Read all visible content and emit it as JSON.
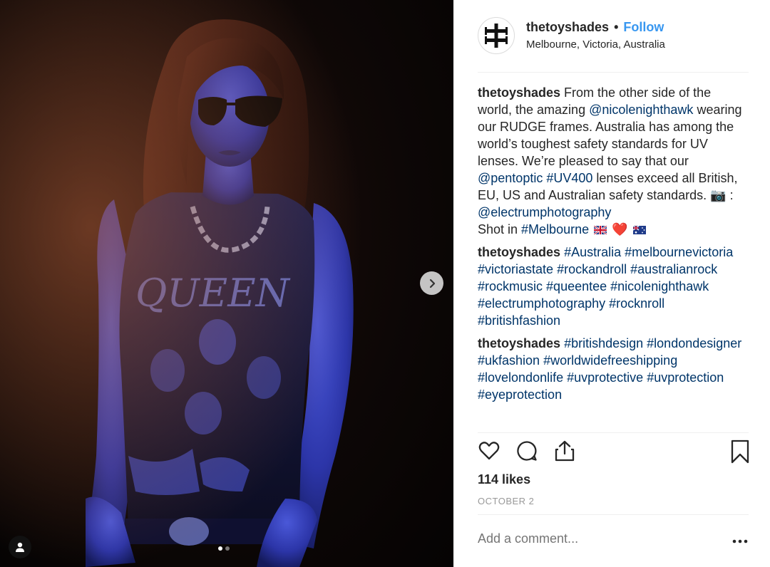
{
  "post": {
    "username": "thetoyshades",
    "separator": "•",
    "follow_label": "Follow",
    "location": "Melbourne, Victoria, Australia",
    "likes": "114 likes",
    "date": "OCTOBER 2",
    "add_comment_placeholder": "Add a comment..."
  },
  "caption": {
    "user": "thetoyshades",
    "t1": " From the other side of the world, the amazing ",
    "m1": "@nicolenighthawk",
    "t2": " wearing our RUDGE frames. Australia has among the world’s toughest safety standards for UV lenses. We’re pleased to say that our ",
    "m2": "@pentoptic",
    "t3": " ",
    "h1": "#UV400",
    "t4": " lenses exceed all British, EU, US and Australian safety standards. 📷 : ",
    "m3": "@electrumphotography",
    "t5": "Shot in ",
    "h2": "#Melbourne",
    "t6": " ❤️ "
  },
  "comment2": {
    "user": "thetoyshades",
    "tags": [
      "#Australia",
      "#melbournevictoria",
      "#victoriastate",
      "#rockandroll",
      "#australianrock",
      "#rockmusic",
      "#queentee",
      "#nicolenighthawk",
      "#electrumphotography",
      "#rocknroll",
      "#britishfashion"
    ]
  },
  "comment3": {
    "user": "thetoyshades",
    "tags": [
      "#britishdesign",
      "#londondesigner",
      "#ukfashion",
      "#worldwidefreeshipping",
      "#lovelondonlife",
      "#uvprotective",
      "#uvprotection",
      "#eyeprotection"
    ]
  },
  "icons": {
    "avatar": "cross-logo-icon",
    "like": "heart-icon",
    "comment": "comment-bubble-icon",
    "share": "share-upload-icon",
    "save": "bookmark-icon",
    "next": "chevron-right-icon",
    "tag": "user-tag-icon",
    "more": "more-dots-icon"
  },
  "colors": {
    "link": "#003569",
    "follow": "#3897f0",
    "muted": "#999999"
  }
}
